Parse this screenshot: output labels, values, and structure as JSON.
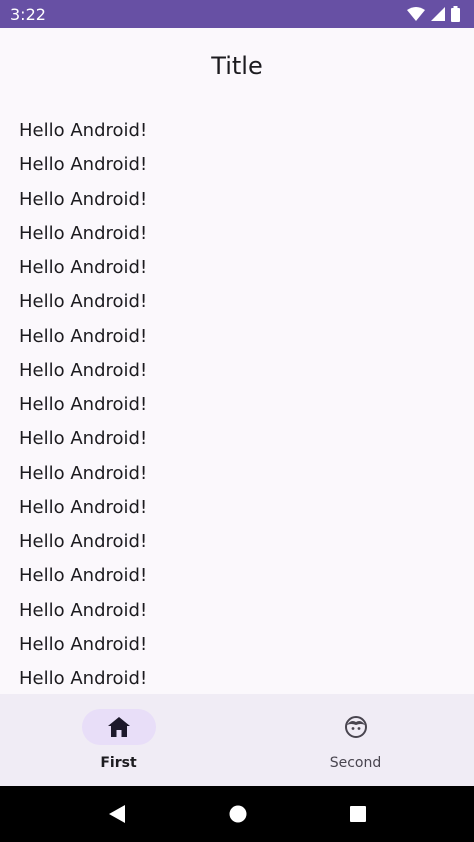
{
  "status_bar": {
    "time": "3:22",
    "icons": [
      "wifi-icon",
      "cellular-icon",
      "battery-icon"
    ]
  },
  "top_bar": {
    "title": "Title"
  },
  "list": {
    "items": [
      "Hello Android!",
      "Hello Android!",
      "Hello Android!",
      "Hello Android!",
      "Hello Android!",
      "Hello Android!",
      "Hello Android!",
      "Hello Android!",
      "Hello Android!",
      "Hello Android!",
      "Hello Android!",
      "Hello Android!",
      "Hello Android!",
      "Hello Android!",
      "Hello Android!",
      "Hello Android!",
      "Hello Android!"
    ]
  },
  "bottom_nav": {
    "items": [
      {
        "label": "First",
        "icon": "home-icon",
        "selected": true
      },
      {
        "label": "Second",
        "icon": "face-icon",
        "selected": false
      }
    ]
  },
  "system_nav": {
    "icons": [
      "back-icon",
      "home-circle-icon",
      "recents-icon"
    ]
  },
  "colors": {
    "status_bar": "#6750a4",
    "background": "#fbf8fc",
    "nav_bar": "#f0ecf5",
    "active_indicator": "#e8def8"
  }
}
